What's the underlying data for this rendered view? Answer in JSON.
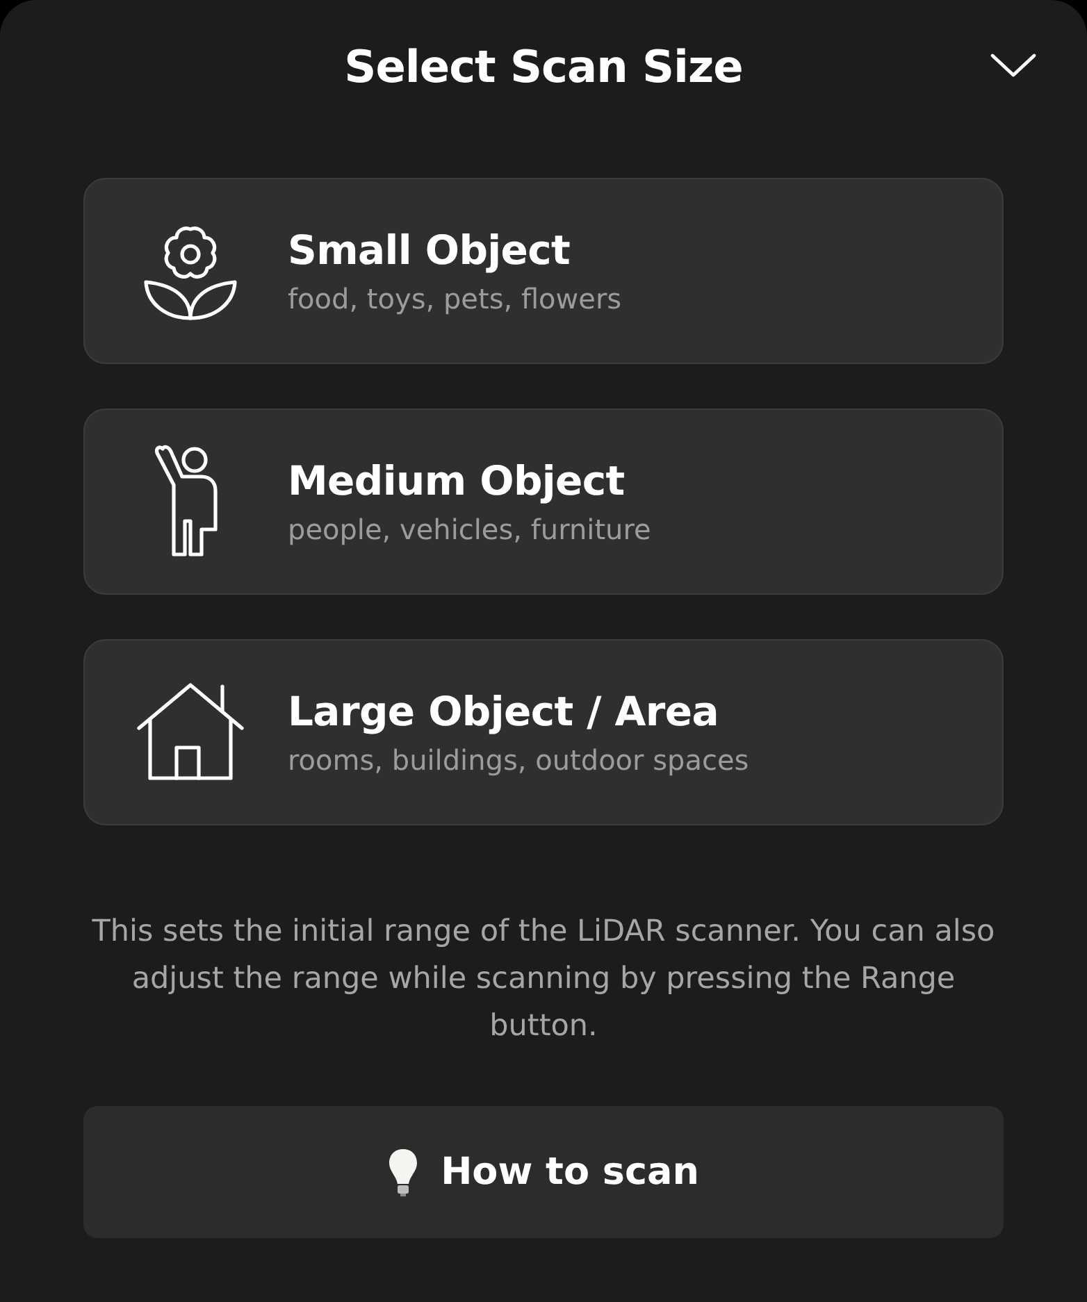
{
  "header": {
    "title": "Select Scan Size"
  },
  "options": [
    {
      "kind": "flower",
      "title": "Small Object",
      "subtitle": "food, toys, pets, flowers"
    },
    {
      "kind": "person",
      "title": "Medium Object",
      "subtitle": "people, vehicles, furniture"
    },
    {
      "kind": "house",
      "title": "Large Object / Area",
      "subtitle": "rooms, buildings, outdoor spaces"
    }
  ],
  "note": "This sets the initial range of the LiDAR scanner. You can also adjust the range while scanning by pressing the Range button.",
  "button": {
    "label": "How to scan"
  }
}
